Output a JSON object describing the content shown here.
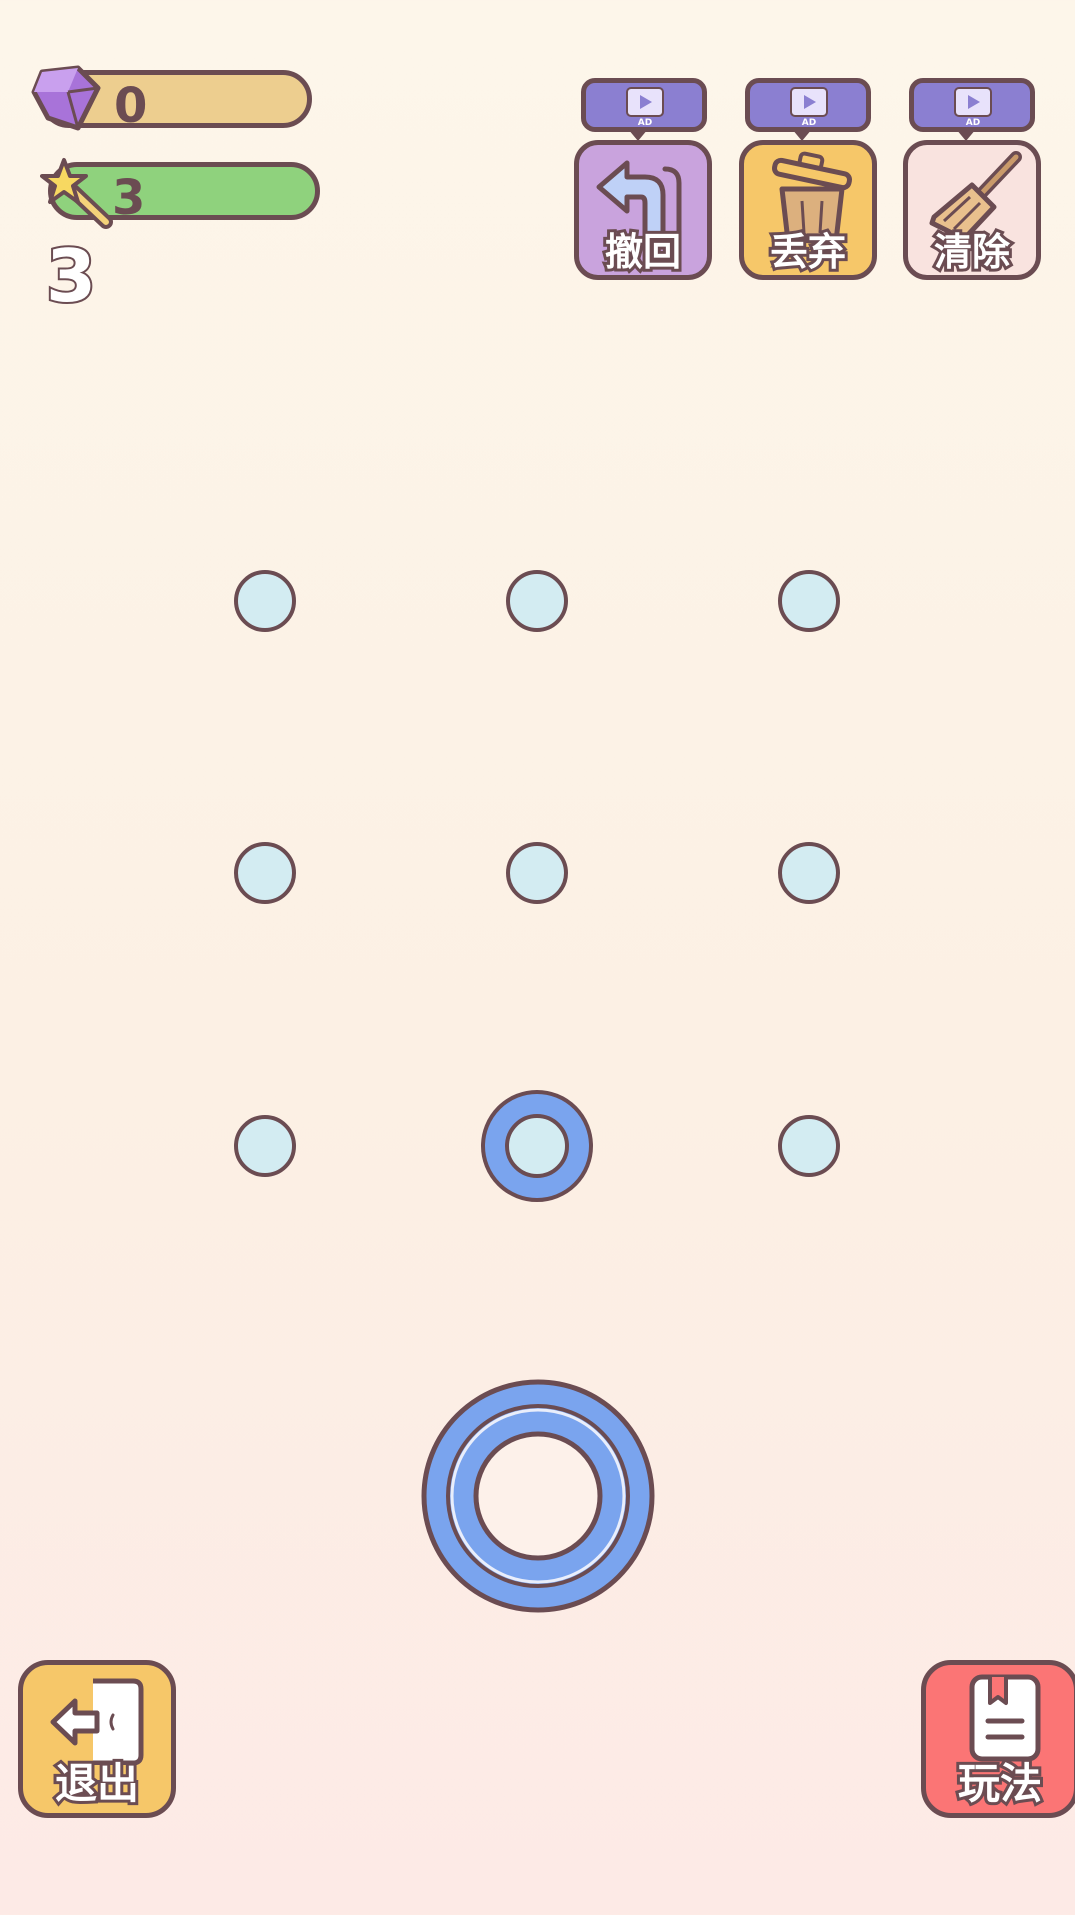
{
  "resources": {
    "gems": {
      "value": "0",
      "icon": "gem-icon",
      "color": "#edce8f"
    },
    "hints": {
      "value": "3",
      "icon": "magic-wand-icon",
      "color": "#8fd27d"
    }
  },
  "level": {
    "number": "3"
  },
  "tools": [
    {
      "id": "undo",
      "label": "撤回",
      "icon": "undo-arrow-icon",
      "color": "#c9a3dd",
      "ad": "AD"
    },
    {
      "id": "discard",
      "label": "丢弃",
      "icon": "trash-can-icon",
      "color": "#f6c769",
      "ad": "AD"
    },
    {
      "id": "clear",
      "label": "清除",
      "icon": "broom-icon",
      "color": "#f9e3df",
      "ad": "AD"
    }
  ],
  "board": {
    "rows": 3,
    "cols": 3,
    "dot_color": "#d3ecf2",
    "ring_color": "#7aa4ee",
    "occupied": [
      {
        "row": 3,
        "col": 2,
        "piece": "small-ring"
      }
    ]
  },
  "current_piece": {
    "type": "large-ring",
    "color": "#7aa4ee"
  },
  "bottom": {
    "exit": {
      "label": "退出",
      "icon": "exit-door-icon",
      "color": "#f6c769"
    },
    "rules": {
      "label": "玩法",
      "icon": "rulebook-icon",
      "color": "#fb7575"
    }
  },
  "colors": {
    "outline": "#6b4c52",
    "ad_tag": "#8b7fd1"
  }
}
